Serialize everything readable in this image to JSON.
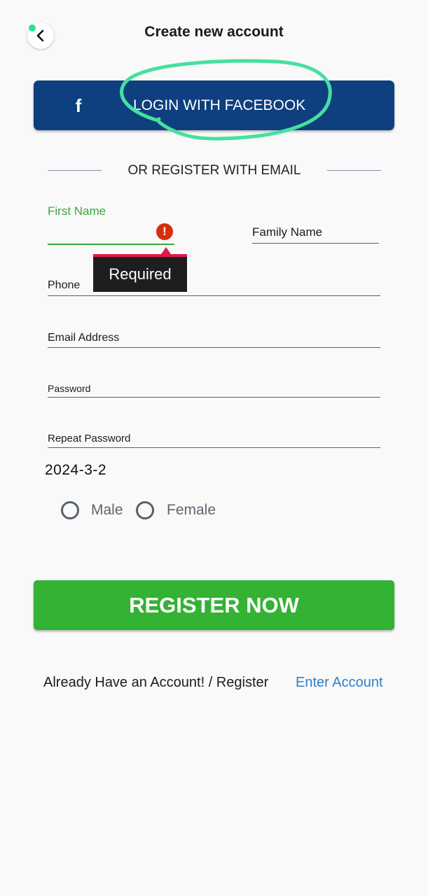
{
  "header": {
    "title": "Create new account",
    "back_icon": "chevron-left-icon"
  },
  "facebook": {
    "icon": "f",
    "label": "LOGIN WITH FACEBOOK",
    "color": "#0e3f7e"
  },
  "divider": {
    "text": "OR REGISTER WITH EMAIL"
  },
  "form": {
    "first_name": {
      "label": "First Name",
      "value": "",
      "error_icon": "!",
      "error_text": "Required"
    },
    "family_name": {
      "label": "Family Name",
      "value": ""
    },
    "phone": {
      "label": "Phone",
      "value": ""
    },
    "email": {
      "label": "Email Address",
      "value": ""
    },
    "password": {
      "label": "Password",
      "value": ""
    },
    "repeat_password": {
      "label": "Repeat Password",
      "value": ""
    },
    "date": "2024-3-2",
    "gender": {
      "options": [
        "Male",
        "Female"
      ],
      "selected": null
    }
  },
  "register_button": {
    "label": "REGISTER NOW",
    "color": "#33b233"
  },
  "footer": {
    "text": "Already Have an Account! / Register",
    "link": "Enter Account"
  }
}
